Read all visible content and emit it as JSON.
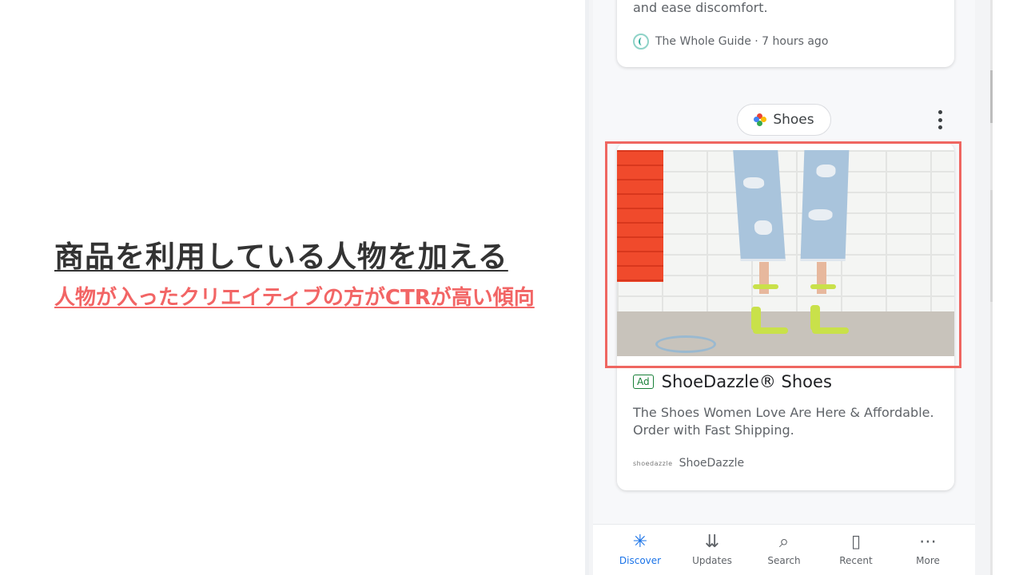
{
  "slide": {
    "headline": "商品を利用している人物を加える",
    "subline": "人物が入ったクリエイティブの方がCTRが高い傾向"
  },
  "feed": {
    "previous_card": {
      "snippet": "and ease discomfort.",
      "source": "The Whole Guide · 7 hours ago"
    },
    "topic_chip": {
      "label": "Shoes",
      "icon": "google-pinwheel-icon"
    },
    "ad_card": {
      "ad_badge": "Ad",
      "title": "ShoeDazzle® Shoes",
      "description": "The Shoes Women Love Are Here & Affordable. Order with Fast Shipping.",
      "advertiser_logo_text": "shoedazzle",
      "advertiser": "ShoeDazzle"
    }
  },
  "bottom_nav": [
    {
      "label": "Discover",
      "icon": "asterisk-icon",
      "active": true
    },
    {
      "label": "Updates",
      "icon": "updates-icon",
      "active": false
    },
    {
      "label": "Search",
      "icon": "search-icon",
      "active": false
    },
    {
      "label": "Recent",
      "icon": "recent-icon",
      "active": false
    },
    {
      "label": "More",
      "icon": "more-icon",
      "active": false
    }
  ],
  "colors": {
    "accent_red": "#ef6661",
    "headline_text": "#333333",
    "active_nav": "#1a73e8",
    "ad_green": "#188038"
  }
}
